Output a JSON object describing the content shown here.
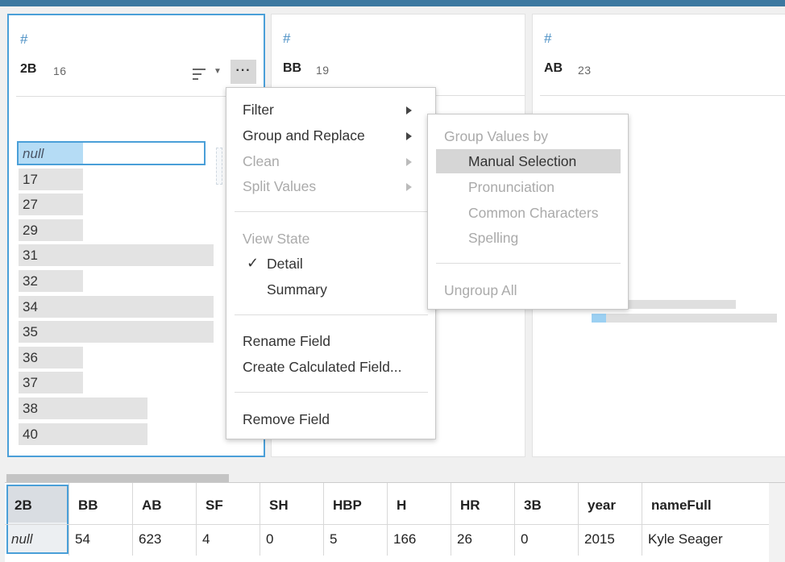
{
  "colors": {
    "accent": "#4a9fd8",
    "topbar": "#3c78a0",
    "null_fill": "#b5dcf5"
  },
  "cards": [
    {
      "type_icon": "#",
      "name": "2B",
      "count": "16"
    },
    {
      "type_icon": "#",
      "name": "BB",
      "count": "19"
    },
    {
      "type_icon": "#",
      "name": "AB",
      "count": "23"
    }
  ],
  "more_button": "···",
  "values": [
    {
      "label": "null",
      "fill": 0.33
    },
    {
      "label": "17",
      "fill": 0.33
    },
    {
      "label": "27",
      "fill": 0.33
    },
    {
      "label": "29",
      "fill": 0.33
    },
    {
      "label": "31",
      "fill": 1.0
    },
    {
      "label": "32",
      "fill": 0.33
    },
    {
      "label": "34",
      "fill": 1.0
    },
    {
      "label": "35",
      "fill": 1.0
    },
    {
      "label": "36",
      "fill": 0.33
    },
    {
      "label": "37",
      "fill": 0.33
    },
    {
      "label": "38",
      "fill": 0.66
    },
    {
      "label": "40",
      "fill": 0.66
    }
  ],
  "context_menu": {
    "filter": "Filter",
    "group_replace": "Group and Replace",
    "clean": "Clean",
    "split_values": "Split Values",
    "view_state": "View State",
    "detail": "Detail",
    "summary": "Summary",
    "rename_field": "Rename Field",
    "create_calc": "Create Calculated Field...",
    "remove_field": "Remove Field",
    "checkmark": "✓"
  },
  "submenu": {
    "header": "Group Values by",
    "manual": "Manual Selection",
    "pronunciation": "Pronunciation",
    "common": "Common Characters",
    "spelling": "Spelling",
    "ungroup": "Ungroup All"
  },
  "table": {
    "columns": [
      "2B",
      "BB",
      "AB",
      "SF",
      "SH",
      "HBP",
      "H",
      "HR",
      "3B",
      "year",
      "nameFull"
    ],
    "row": [
      "null",
      "54",
      "623",
      "4",
      "0",
      "5",
      "166",
      "26",
      "0",
      "2015",
      "Kyle Seager"
    ]
  }
}
